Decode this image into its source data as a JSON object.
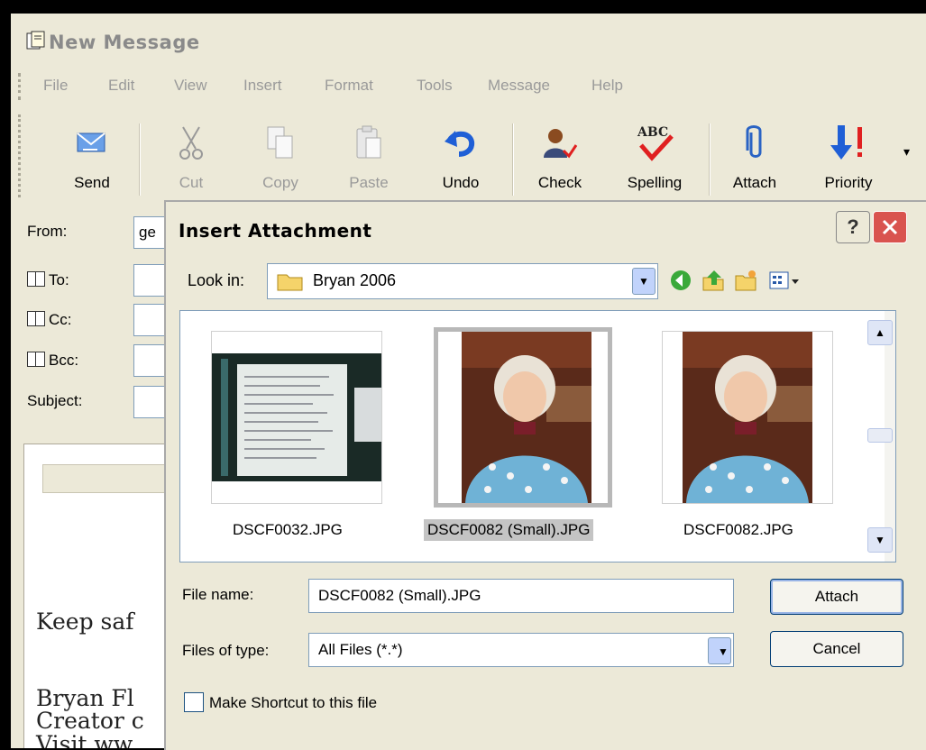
{
  "window": {
    "title": "New Message"
  },
  "menu": [
    "File",
    "Edit",
    "View",
    "Insert",
    "Format",
    "Tools",
    "Message",
    "Help"
  ],
  "toolbar": [
    {
      "label": "Send",
      "icon": "send-icon",
      "enabled": true
    },
    {
      "label": "Cut",
      "icon": "scissors-icon",
      "enabled": false
    },
    {
      "label": "Copy",
      "icon": "copy-icon",
      "enabled": false
    },
    {
      "label": "Paste",
      "icon": "paste-icon",
      "enabled": false
    },
    {
      "label": "Undo",
      "icon": "undo-icon",
      "enabled": true
    },
    {
      "label": "Check",
      "icon": "check-names-icon",
      "enabled": true
    },
    {
      "label": "Spelling",
      "icon": "spelling-icon",
      "enabled": true
    },
    {
      "label": "Attach",
      "icon": "paperclip-icon",
      "enabled": true
    },
    {
      "label": "Priority",
      "icon": "priority-icon",
      "enabled": true
    }
  ],
  "headers": {
    "from_label": "From:",
    "from_value": "ge",
    "to_label": "To:",
    "cc_label": "Cc:",
    "bcc_label": "Bcc:",
    "subject_label": "Subject:"
  },
  "body_text": {
    "line1": "Keep saf",
    "line2": "Bryan Fl",
    "line3": "Creator c",
    "line4": "Visit ww"
  },
  "dialog": {
    "title": "Insert Attachment",
    "help_label": "?",
    "look_in_label": "Look in:",
    "look_in_value": "Bryan 2006",
    "files": [
      {
        "name": "DSCF0032.JPG",
        "selected": false
      },
      {
        "name": "DSCF0082 (Small).JPG",
        "selected": true
      },
      {
        "name": "DSCF0082.JPG",
        "selected": false
      }
    ],
    "file_name_label": "File name:",
    "file_name_value": "DSCF0082 (Small).JPG",
    "files_of_type_label": "Files of type:",
    "files_of_type_value": "All Files (*.*)",
    "attach_button": "Attach",
    "cancel_button": "Cancel",
    "shortcut_label": "Make Shortcut to this file",
    "shortcut_checked": false
  },
  "colors": {
    "window_bg": "#ece9d8",
    "close_red": "#d9534f",
    "selection_gray": "#c4c4c4"
  }
}
